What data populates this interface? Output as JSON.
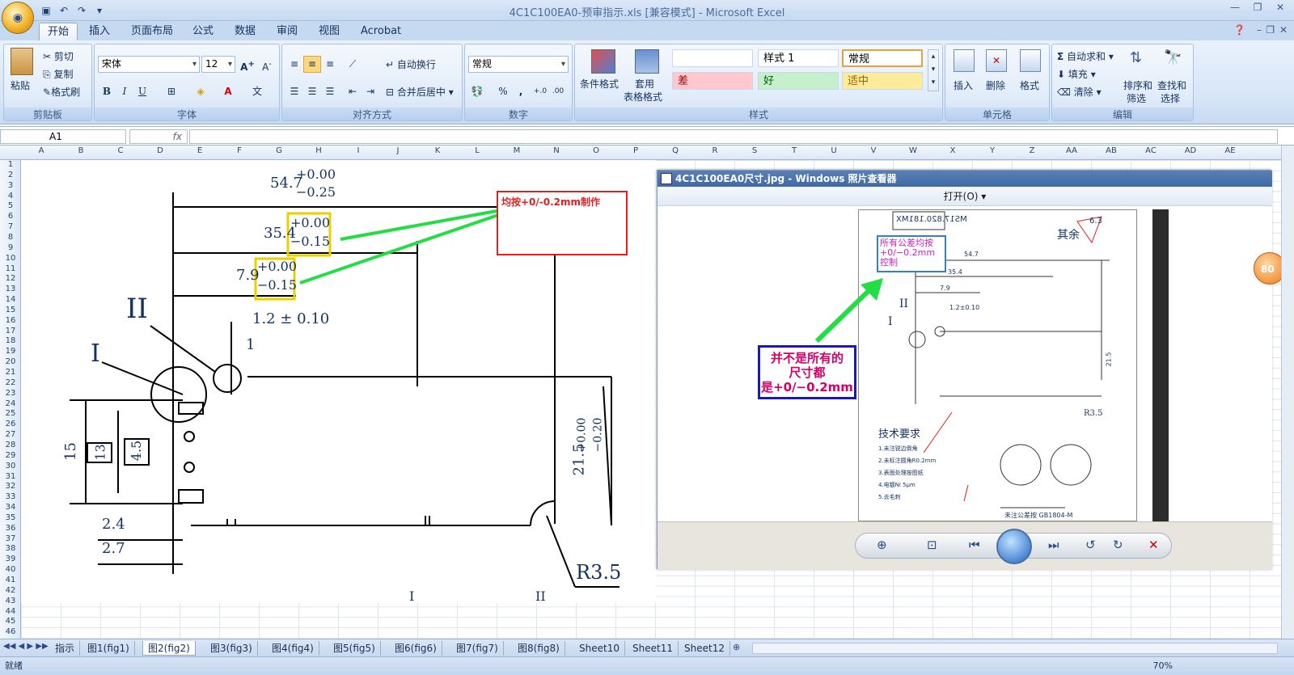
{
  "app": {
    "title": "4C1C100EA0-预审指示.xls  [兼容模式] - Microsoft Excel",
    "colors": {
      "ribbon": "#dbe7f7",
      "accent": "#15325f",
      "red_note": "#e02020",
      "blue_note": "#1a1ab0"
    }
  },
  "ribbon_tabs": [
    "开始",
    "插入",
    "页面布局",
    "公式",
    "数据",
    "审阅",
    "视图",
    "Acrobat"
  ],
  "clipboard": {
    "paste": "粘贴",
    "cut": "剪切",
    "copy": "复制",
    "format_painter": "格式刷",
    "group": "剪贴板"
  },
  "font": {
    "name": "宋体",
    "size": "12",
    "group": "字体",
    "bold": "B",
    "italic": "I",
    "underline": "U"
  },
  "alignment": {
    "wrap": "自动换行",
    "merge": "合并后居中",
    "group": "对齐方式"
  },
  "number": {
    "format": "常规",
    "percent": "%",
    "comma": ",",
    "group": "数字"
  },
  "styles": {
    "conditional": "条件格式",
    "table": "套用",
    "table2": "表格格式",
    "cells": [
      "",
      "样式 1",
      "常规",
      "差",
      "好",
      "适中"
    ],
    "group": "样式"
  },
  "cells_group": {
    "insert": "插入",
    "delete": "删除",
    "format": "格式",
    "group": "单元格"
  },
  "editing": {
    "autosum": "自动求和",
    "fill": "填充",
    "clear": "清除",
    "sort": "排序和",
    "sort2": "筛选",
    "find": "查找和",
    "find2": "选择",
    "group": "编辑"
  },
  "formula_bar": {
    "namebox": "A1",
    "fx": "fx"
  },
  "columns": [
    "A",
    "B",
    "C",
    "D",
    "E",
    "F",
    "G",
    "H",
    "I",
    "J",
    "K",
    "L",
    "M",
    "N",
    "O",
    "P",
    "Q",
    "R",
    "S",
    "T",
    "U",
    "V",
    "W",
    "X",
    "Y",
    "Z",
    "AA",
    "AB",
    "AC",
    "AD",
    "AE"
  ],
  "rows": [
    "1",
    "2",
    "3",
    "4",
    "5",
    "6",
    "7",
    "8",
    "9",
    "10",
    "11",
    "12",
    "13",
    "14",
    "15",
    "16",
    "17",
    "18",
    "19",
    "20",
    "21",
    "22",
    "23",
    "24",
    "25",
    "26",
    "27",
    "28",
    "29",
    "30",
    "31",
    "32",
    "33",
    "34",
    "35",
    "36",
    "37",
    "38",
    "39",
    "40",
    "41",
    "42",
    "43",
    "44",
    "45",
    "46"
  ],
  "drawing": {
    "dim_top": "54.7",
    "dim_top_tol_up": "+0.00",
    "dim_top_tol_dn": "−0.25",
    "dim_mid": "35.4",
    "dim_mid_tol_up": "+0.00",
    "dim_mid_tol_dn": "−0.15",
    "dim_small": "7.9",
    "dim_small_tol_up": "+0.00",
    "dim_small_tol_dn": "−0.15",
    "dim_12": "1.2 ± 0.10",
    "label_II": "II",
    "label_I": "I",
    "label_1": "1",
    "dim_15": "15",
    "dim_13": "13",
    "dim_45": "4.5",
    "dim_24": "2.4",
    "dim_27": "2.7",
    "dim_215": "21.5",
    "dim_215_tol_up": "+0.00",
    "dim_215_tol_dn": "−0.20",
    "dim_r35": "R3.5",
    "bottom_I": "I",
    "bottom_II": "II"
  },
  "notes": {
    "red": "均按+0/-0.2mm制作",
    "blue_line1": "并不是所有的",
    "blue_line2": "尺寸都",
    "blue_line3": "是+0/−0.2mm",
    "cyan": "所有公差均按+0/−0.2mm控制",
    "orange": "80"
  },
  "viewer": {
    "title": "4C1C100EA0尺寸.jpg - Windows 照片查看器",
    "open_menu": "打开(O)",
    "img_stamp": "MS17.820.181MX",
    "img_other": "其余",
    "img_roughness": "6.3",
    "img_tech": "技术要求",
    "img_tol_note": "未注公差按 GB1804-M",
    "img_r35": "R3.5",
    "img_dim_top": "54.7",
    "img_dim_mid": "35.4",
    "img_dim_small": "7.9",
    "img_dim_12": "1.2±0.10",
    "img_dim_215": "21.5",
    "img_II": "II",
    "img_I": "I",
    "img_tech_lines": [
      "1.未注锐边倒角",
      "2.未标注圆角R0.2mm",
      "3.表面处理按图纸",
      "4.电镀Ni 5μm",
      "5.去毛刺"
    ]
  },
  "sheets": [
    "指示",
    "图1(fig1)",
    "图2(fig2)",
    "图3(fig3)",
    "图4(fig4)",
    "图5(fig5)",
    "图6(fig6)",
    "图7(fig7)",
    "图8(fig8)",
    "Sheet10",
    "Sheet11",
    "Sheet12"
  ],
  "status": {
    "ready": "就绪",
    "zoom": "70%"
  }
}
